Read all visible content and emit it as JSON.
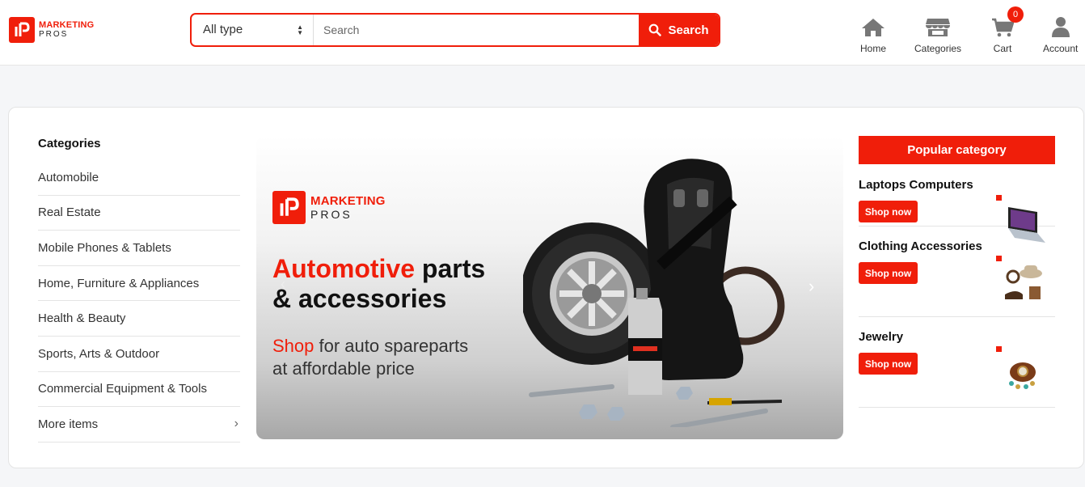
{
  "brand": {
    "line1": "MARKETING",
    "line2": "PROS"
  },
  "search": {
    "type_value": "All type",
    "placeholder": "Search",
    "button_label": "Search"
  },
  "nav": {
    "home": "Home",
    "categories": "Categories",
    "cart": "Cart",
    "cart_count": "0",
    "account": "Account"
  },
  "sidebar": {
    "title": "Categories",
    "items": [
      {
        "label": "Automobile"
      },
      {
        "label": "Real Estate"
      },
      {
        "label": "Mobile Phones & Tablets"
      },
      {
        "label": "Home, Furniture & Appliances"
      },
      {
        "label": "Health & Beauty"
      },
      {
        "label": "Sports, Arts & Outdoor"
      },
      {
        "label": "Commercial Equipment & Tools"
      },
      {
        "label": "More items"
      }
    ]
  },
  "banner": {
    "brand_line1": "MARKETING",
    "brand_line2": "PROS",
    "headline_red": "Automotive",
    "headline_rest1": " parts",
    "headline_line2": "& accessories",
    "sub_red": "Shop",
    "sub_rest1": " for auto spareparts",
    "sub_line2": "at affordable price"
  },
  "popular": {
    "title": "Popular category",
    "items": [
      {
        "name": "Laptops Computers",
        "button": "Shop now",
        "icon": "laptop-image"
      },
      {
        "name": "Clothing Accessories",
        "button": "Shop now",
        "icon": "clothing-accessories-image"
      },
      {
        "name": "Jewelry",
        "button": "Shop now",
        "icon": "jewelry-image"
      }
    ]
  },
  "colors": {
    "accent": "#f01e0a"
  }
}
